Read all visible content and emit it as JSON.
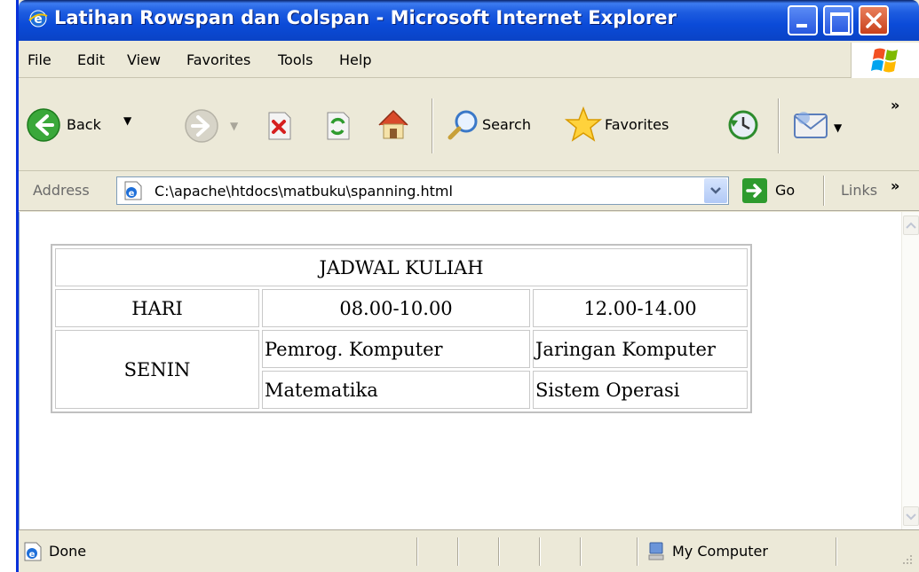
{
  "window": {
    "title": "Latihan Rowspan dan Colspan - Microsoft Internet Explorer"
  },
  "menu": [
    "File",
    "Edit",
    "View",
    "Favorites",
    "Tools",
    "Help"
  ],
  "toolbar": {
    "back_label": "Back",
    "search_label": "Search",
    "favorites_label": "Favorites",
    "more": "»"
  },
  "address": {
    "label": "Address",
    "value": "C:\\apache\\htdocs\\matbuku\\spanning.html",
    "go_label": "Go",
    "links_label": "Links",
    "more": "»"
  },
  "table": {
    "title": "JADWAL KULIAH",
    "headers": [
      "HARI",
      "08.00-10.00",
      "12.00-14.00"
    ],
    "day": "SENIN",
    "rows": [
      [
        "Pemrog. Komputer",
        "Jaringan Komputer"
      ],
      [
        "Matematika",
        "Sistem Operasi"
      ]
    ]
  },
  "status": {
    "text": "Done",
    "zone": "My Computer"
  },
  "colors": {
    "titlebar": "#0B4BD8",
    "chrome": "#ECE9D8",
    "close": "#C8401C"
  }
}
